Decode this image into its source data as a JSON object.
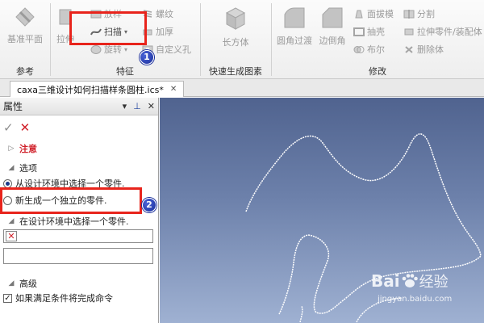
{
  "ribbon": {
    "groups": {
      "reference": "参考",
      "features": "特征",
      "quick": "快速生成图素",
      "modify": "修改"
    },
    "datum_plane": "基准平面",
    "extrude": "拉伸",
    "sweep": "扫描",
    "loft": "放样",
    "thread": "螺纹",
    "add_thick": "加厚",
    "custom_hole": "自定义孔",
    "rotate": "旋转",
    "box": "长方体",
    "fillet": "圆角过渡",
    "chamfer": "边倒角",
    "draft": "面拔模",
    "shell": "抽壳",
    "boolean": "布尔",
    "split": "分割",
    "stretch_part": "拉伸零件/装配体",
    "delete_body": "删除体"
  },
  "annotations": {
    "badge1": "1",
    "badge2": "2"
  },
  "doc_tab": {
    "title": "caxa三维设计如何扫描样条圆柱.ics*",
    "close": "✕"
  },
  "panel": {
    "title": "属性",
    "ok": "✓",
    "cancel": "✕",
    "notice": "注意",
    "options": "选项",
    "option_select": "从设计环境中选择一个零件.",
    "option_new": "新生成一个独立的零件.",
    "select_heading": "在设计环境中选择一个零件.",
    "advanced": "高级",
    "auto_finish": "如果满足条件将完成命令"
  },
  "watermark": {
    "brand": "Bai",
    "brand2": "经验",
    "url": "jingyan.baidu.com"
  },
  "colors": {
    "highlight": "#e8241c",
    "badge": "#1a2e9a",
    "viewport_top": "#50638f",
    "viewport_bottom": "#9fb1d2",
    "notice": "#d0202a"
  }
}
